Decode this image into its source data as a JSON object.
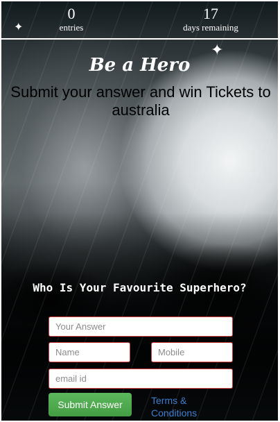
{
  "stats": {
    "entries": {
      "value": "0",
      "label": "entries"
    },
    "days": {
      "value": "17",
      "label": "days remaining"
    }
  },
  "hero": {
    "title": "Be a Hero",
    "subtitle": "Submit your answer and win Tickets to australia"
  },
  "question": "Who Is Your Favourite Superhero?",
  "form": {
    "answer_placeholder": "Your Answer",
    "name_placeholder": "Name",
    "mobile_placeholder": "Mobile",
    "email_placeholder": "email id",
    "submit_label": "Submit Answer",
    "terms_label": "Terms & Conditions"
  },
  "colors": {
    "button": "#5cb85c",
    "link": "#3a7fd0",
    "input_border": "#d64040"
  },
  "icons": [
    "sparkle-icon"
  ]
}
